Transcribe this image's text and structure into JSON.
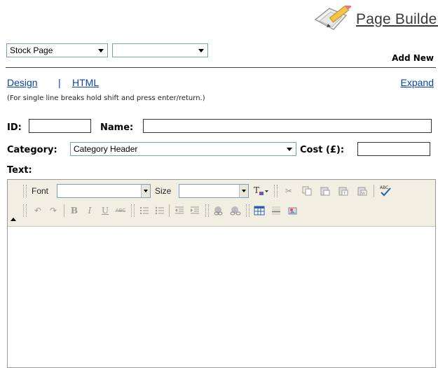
{
  "logo": {
    "title": "Page Builder"
  },
  "selects": {
    "page_type": "Stock Page",
    "second": ""
  },
  "add_new": "Add New",
  "modes": {
    "design": "Design",
    "separator": "|",
    "html": "HTML",
    "expand": "Expand"
  },
  "hint": "(For single line breaks hold shift and press enter/return.)",
  "fields": {
    "id_label": "ID:",
    "id_value": "",
    "name_label": "Name:",
    "name_value": "",
    "category_label": "Category:",
    "category_value": "Category Header",
    "cost_label": "Cost (£):",
    "cost_value": "",
    "text_label": "Text:"
  },
  "toolbar": {
    "font_label": "Font",
    "font_value": "",
    "size_label": "Size",
    "size_value": "",
    "icons_row1": [
      "text-color-icon",
      "cut-icon",
      "copy-icon",
      "paste-icon",
      "paste-text-icon",
      "paste-word-icon",
      "spellcheck-icon"
    ],
    "icons_row2": [
      "undo-icon",
      "redo-icon",
      "bold-icon",
      "italic-icon",
      "underline-icon",
      "strikethrough-icon",
      "ordered-list-icon",
      "unordered-list-icon",
      "outdent-icon",
      "indent-icon",
      "link-icon",
      "unlink-icon",
      "table-icon",
      "horizontal-rule-icon",
      "image-icon"
    ]
  },
  "colors": {
    "link": "#0645ad",
    "toolbar_bg": "#f1efe2",
    "border": "#7f9db9"
  }
}
